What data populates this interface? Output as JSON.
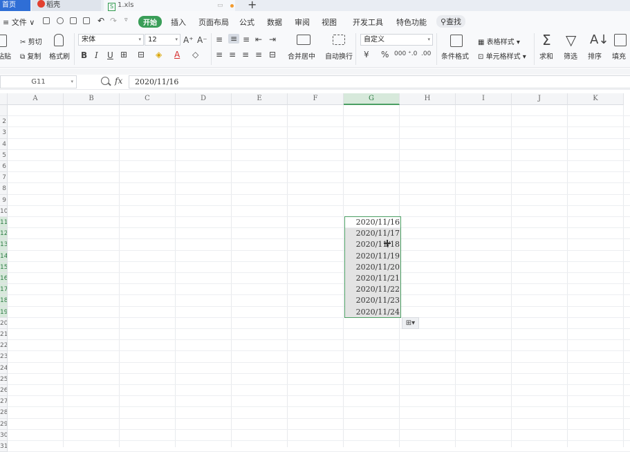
{
  "tabs": {
    "home": "首页",
    "wps": "稻壳",
    "file": "1.xls"
  },
  "menu": {
    "file": "≡ 文件 ∨",
    "items": [
      "开始",
      "插入",
      "页面布局",
      "公式",
      "数据",
      "审阅",
      "视图",
      "开发工具",
      "特色功能"
    ],
    "search": "查找"
  },
  "ribbon": {
    "paste": "粘贴",
    "cut": "剪切",
    "copy": "复制",
    "format_painter": "格式刷",
    "font_name": "宋体",
    "font_size": "12",
    "merge_center": "合并居中",
    "wrap_text": "自动换行",
    "number_format": "自定义",
    "conditional_format": "条件格式",
    "table_style": "表格样式",
    "cell_style": "单元格样式",
    "sum": "求和",
    "filter": "筛选",
    "sort": "排序",
    "fill": "填充"
  },
  "formula_bar": {
    "name_box": "G11",
    "fx": "fx",
    "value": "2020/11/16"
  },
  "sheet": {
    "columns": [
      "A",
      "B",
      "C",
      "D",
      "E",
      "F",
      "G",
      "H",
      "I",
      "J",
      "K"
    ],
    "selected_column": "G",
    "row_numbers": [
      "",
      "2",
      "3",
      "4",
      "5",
      "6",
      "7",
      "8",
      "9",
      "10",
      "11",
      "12",
      "13",
      "14",
      "15",
      "16",
      "17",
      "18",
      "19",
      "20",
      "21",
      "22",
      "23",
      "24",
      "25",
      "26",
      "27",
      "28",
      "29",
      "30",
      "31"
    ],
    "selected_rows": [
      "11",
      "12",
      "13",
      "14",
      "15",
      "16",
      "17",
      "18",
      "19"
    ],
    "dates": [
      "2020/11/16",
      "2020/11/17",
      "2020/11/18",
      "2020/11/19",
      "2020/11/20",
      "2020/11/21",
      "2020/11/22",
      "2020/11/23",
      "2020/11/24"
    ],
    "autofill_icon": "autofill-options-icon",
    "selection_color": "#4a9e62"
  }
}
